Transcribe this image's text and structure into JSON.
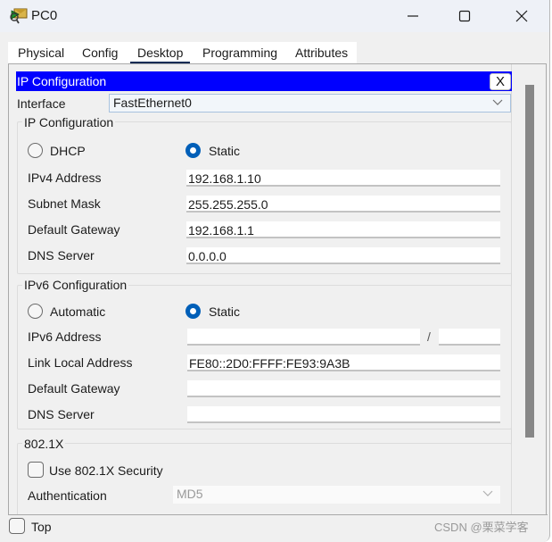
{
  "window": {
    "title": "PC0",
    "icon": "pc-device-icon",
    "controls": {
      "minimize": "minimize-icon",
      "maximize": "maximize-icon",
      "close": "close-icon"
    }
  },
  "tabs": [
    {
      "label": "Physical",
      "active": false
    },
    {
      "label": "Config",
      "active": false
    },
    {
      "label": "Desktop",
      "active": true
    },
    {
      "label": "Programming",
      "active": false
    },
    {
      "label": "Attributes",
      "active": false
    }
  ],
  "panel": {
    "title": "IP Configuration",
    "close_label": "X",
    "header_color": "#0000ff",
    "interface_label": "Interface",
    "interface_value": "FastEthernet0"
  },
  "ipv4": {
    "group_title": "IP Configuration",
    "mode_options": [
      {
        "label": "DHCP",
        "selected": false
      },
      {
        "label": "Static",
        "selected": true
      }
    ],
    "fields": [
      {
        "label": "IPv4 Address",
        "value": "192.168.1.10"
      },
      {
        "label": "Subnet Mask",
        "value": "255.255.255.0"
      },
      {
        "label": "Default Gateway",
        "value": "192.168.1.1"
      },
      {
        "label": "DNS Server",
        "value": "0.0.0.0"
      }
    ]
  },
  "ipv6": {
    "group_title": "IPv6 Configuration",
    "mode_options": [
      {
        "label": "Automatic",
        "selected": false
      },
      {
        "label": "Static",
        "selected": true
      }
    ],
    "address_label": "IPv6 Address",
    "address_value": "",
    "prefix_separator": "/",
    "prefix_value": "",
    "fields": [
      {
        "label": "Link Local Address",
        "value": "FE80::2D0:FFFF:FE93:9A3B"
      },
      {
        "label": "Default Gateway",
        "value": ""
      },
      {
        "label": "DNS Server",
        "value": ""
      }
    ]
  },
  "dot1x": {
    "group_title": "802.1X",
    "use_security_label": "Use 802.1X Security",
    "use_security_checked": false,
    "auth_label": "Authentication",
    "auth_value": "MD5"
  },
  "footer": {
    "top_label": "Top",
    "top_checked": false,
    "watermark": "CSDN @栗菜学客"
  },
  "colors": {
    "radio_selected": "#005fb8",
    "tab_underline": "#0e2b55",
    "scroll_thumb": "#878787"
  }
}
